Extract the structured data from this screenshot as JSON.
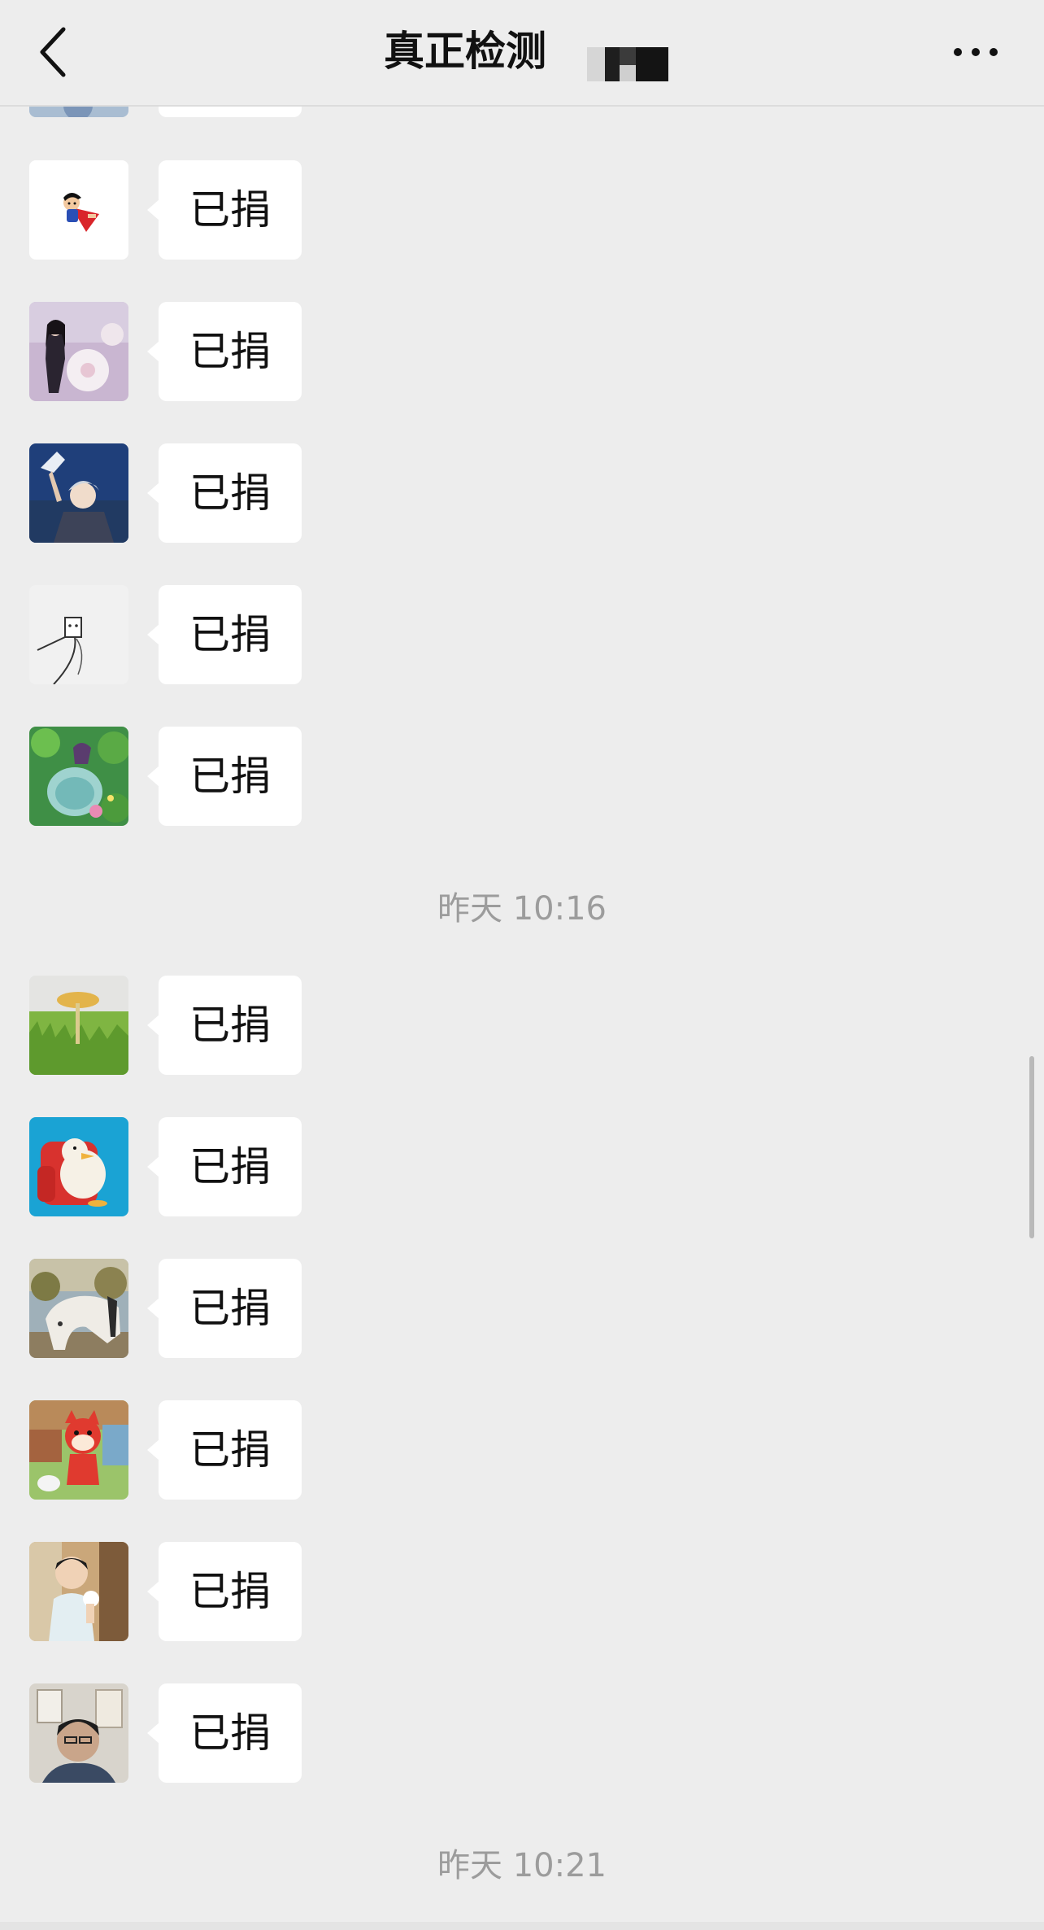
{
  "navbar": {
    "title": "真正检测",
    "back_icon": "chevron-left-icon",
    "more_icon": "ellipsis-icon"
  },
  "chat": {
    "messages_before_first_timestamp": [
      {
        "sender": "avatar-partial",
        "text": ""
      },
      {
        "sender": "avatar-superhero-cartoon",
        "text": "已捐"
      },
      {
        "sender": "avatar-girl-with-flowers",
        "text": "已捐"
      },
      {
        "sender": "avatar-anime-boy-with-bird",
        "text": "已捐"
      },
      {
        "sender": "avatar-line-sketch",
        "text": "已捐"
      },
      {
        "sender": "avatar-mermaid-illustration",
        "text": "已捐"
      }
    ],
    "timestamp_1": "昨天 10:16",
    "messages_after_first_timestamp": [
      {
        "sender": "avatar-mushroom-on-grass",
        "text": "已捐"
      },
      {
        "sender": "avatar-duck-on-red-sofa",
        "text": "已捐"
      },
      {
        "sender": "avatar-white-horse",
        "text": "已捐"
      },
      {
        "sender": "avatar-cartoon-red-fox",
        "text": "已捐"
      },
      {
        "sender": "avatar-toddler-photo",
        "text": "已捐"
      },
      {
        "sender": "avatar-man-portrait",
        "text": "已捐"
      }
    ],
    "timestamp_2": "昨天 10:21"
  },
  "colors": {
    "background": "#ededed",
    "bubble": "#ffffff",
    "timestamp_text": "#9c9c9c",
    "title_text": "#111111"
  }
}
